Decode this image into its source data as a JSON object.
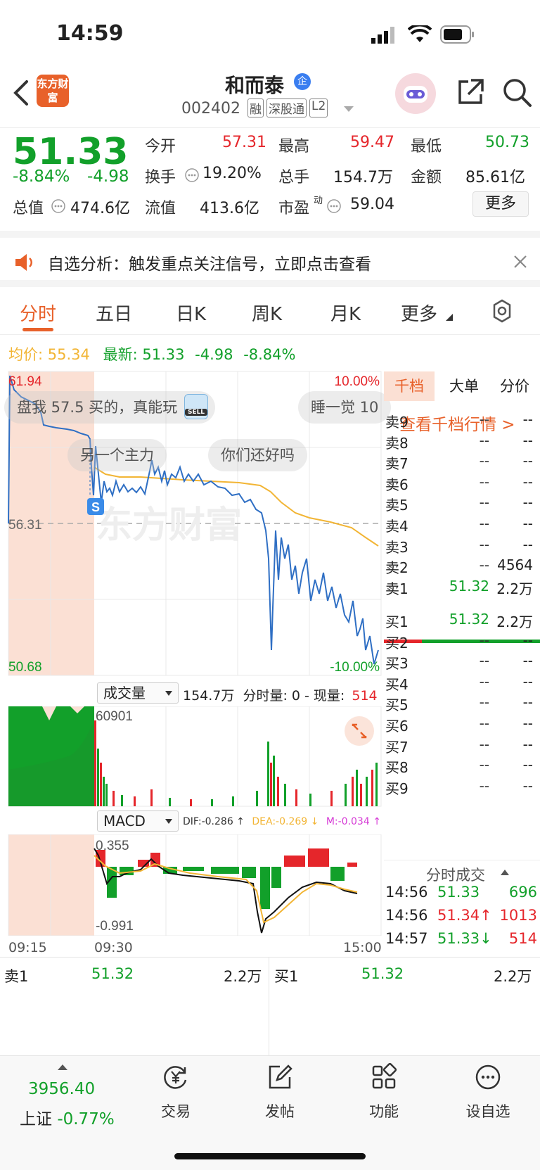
{
  "status": {
    "time": "14:59"
  },
  "header": {
    "logo_text": "东方财富",
    "stock_name": "和而泰",
    "stock_code": "002402",
    "badges": [
      "融",
      "深股通",
      "L2"
    ],
    "corp_badge": "企"
  },
  "quote": {
    "price": "51.33",
    "change_pct": "-8.84%",
    "change": "-4.98",
    "open_label": "今开",
    "open": "57.31",
    "high_label": "最高",
    "high": "59.47",
    "low_label": "最低",
    "low": "50.73",
    "turnover_label": "换手",
    "turnover": "19.20%",
    "volume_label": "总手",
    "volume": "154.7万",
    "amount_label": "金额",
    "amount": "85.61亿",
    "mktcap_label": "总值",
    "mktcap": "474.6亿",
    "float_label": "流值",
    "float": "413.6亿",
    "pe_label": "市盈",
    "pe_sup": "动",
    "pe": "59.04",
    "more_label": "更多"
  },
  "notice": {
    "text": "自选分析：触发重点关注信号，立即点击查看"
  },
  "tabs": [
    {
      "label": "分时"
    },
    {
      "label": "五日"
    },
    {
      "label": "日K"
    },
    {
      "label": "周K"
    },
    {
      "label": "月K"
    },
    {
      "label": "更多"
    }
  ],
  "chart_info": {
    "avg_label": "均价:",
    "avg": "55.34",
    "latest_label": "最新:",
    "latest": "51.33",
    "change": "-4.98",
    "change_pct": "-8.84%"
  },
  "main_chart": {
    "top_price": "61.94",
    "mid_price": "56.31",
    "bottom_price": "50.68",
    "top_pct": "10.00%",
    "bottom_pct": "-10.00%",
    "sell_marker": "S",
    "sell_sticker": "SELL"
  },
  "comments": [
    {
      "text": "盘我 57.5 买的，真能玩"
    },
    {
      "text": "睡一觉 10"
    },
    {
      "text": "另一个主力"
    },
    {
      "text": "你们还好吗"
    }
  ],
  "watermark": "东方财富",
  "volume_panel": {
    "selector": "成交量",
    "total": "154.7万",
    "info": "分时量: 0 - 现量:",
    "current": "514",
    "max": "60901"
  },
  "macd_panel": {
    "selector": "MACD",
    "dif": "DIF:-0.286 ↑",
    "dea": "DEA:-0.269 ↓",
    "m": "M:-0.034 ↑",
    "top": "0.355",
    "bottom": "-0.991"
  },
  "time_axis": {
    "t1": "09:15",
    "t2": "09:30",
    "t3": "15:00"
  },
  "orderbook": {
    "tabs": [
      "千档",
      "大单",
      "分价"
    ],
    "link": "查看千档行情 >",
    "asks": [
      {
        "label": "卖9",
        "price": "--",
        "vol": "--"
      },
      {
        "label": "卖8",
        "price": "--",
        "vol": "--"
      },
      {
        "label": "卖7",
        "price": "--",
        "vol": "--"
      },
      {
        "label": "卖6",
        "price": "--",
        "vol": "--"
      },
      {
        "label": "卖5",
        "price": "--",
        "vol": "--"
      },
      {
        "label": "卖4",
        "price": "--",
        "vol": "--"
      },
      {
        "label": "卖3",
        "price": "--",
        "vol": "--"
      },
      {
        "label": "卖2",
        "price": "--",
        "vol": "4564"
      },
      {
        "label": "卖1",
        "price": "51.32",
        "vol": "2.2万"
      }
    ],
    "bids": [
      {
        "label": "买1",
        "price": "51.32",
        "vol": "2.2万"
      },
      {
        "label": "买2",
        "price": "--",
        "vol": "--"
      },
      {
        "label": "买3",
        "price": "--",
        "vol": "--"
      },
      {
        "label": "买4",
        "price": "--",
        "vol": "--"
      },
      {
        "label": "买5",
        "price": "--",
        "vol": "--"
      },
      {
        "label": "买6",
        "price": "--",
        "vol": "--"
      },
      {
        "label": "买7",
        "price": "--",
        "vol": "--"
      },
      {
        "label": "买8",
        "price": "--",
        "vol": "--"
      },
      {
        "label": "买9",
        "price": "--",
        "vol": "--"
      }
    ],
    "trades_title": "分时成交",
    "trades": [
      {
        "time": "14:56",
        "price": "51.33",
        "vol": "696"
      },
      {
        "time": "14:56",
        "price": "51.34↑",
        "vol": "1013"
      },
      {
        "time": "14:57",
        "price": "51.33↓",
        "vol": "514"
      }
    ]
  },
  "bottom_quote": {
    "sell_label": "卖1",
    "sell_price": "51.32",
    "sell_vol": "2.2万",
    "buy_label": "买1",
    "buy_price": "51.32",
    "buy_vol": "2.2万"
  },
  "footer": {
    "index_value": "3956.40",
    "index_name": "上证",
    "index_change": "-0.77%",
    "nav": [
      {
        "label": "交易",
        "icon": "yuan-cycle-icon"
      },
      {
        "label": "发帖",
        "icon": "edit-icon"
      },
      {
        "label": "功能",
        "icon": "grid-icon"
      },
      {
        "label": "设自选",
        "icon": "more-icon"
      }
    ]
  },
  "colors": {
    "up": "#e5262b",
    "down": "#12a02a",
    "accent": "#e8612a",
    "price_line": "#2f6fc4",
    "avg_line": "#f2b535"
  }
}
